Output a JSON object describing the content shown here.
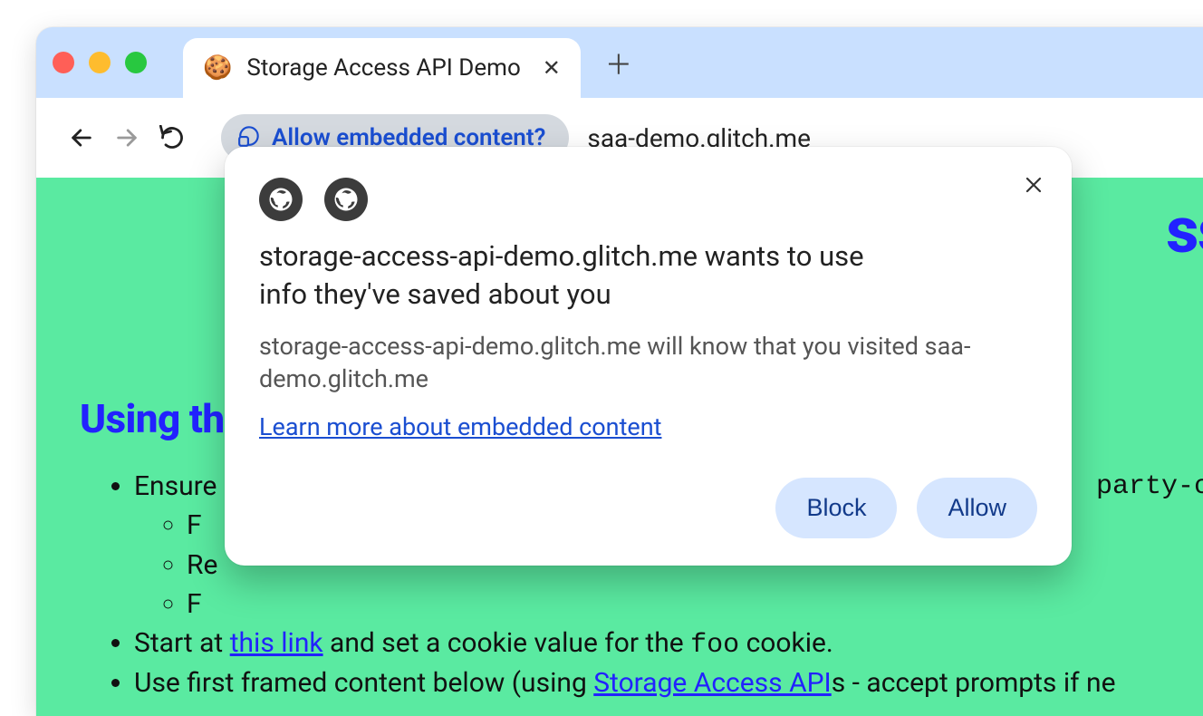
{
  "tab": {
    "title": "Storage Access API Demo",
    "favicon": "🍪"
  },
  "chip": {
    "label": "Allow embedded content?"
  },
  "url": "saa-demo.glitch.me",
  "page": {
    "big_heading_fragment": "ss A",
    "section_heading": "Using thi",
    "li_ensure": "Ensure ",
    "li_sub1": "F",
    "li_sub2": "Re",
    "li_sub3": "F",
    "li_flag_suffix": "party-coo",
    "li_start_prefix": "Start at ",
    "li_start_link": "this link",
    "li_start_mid": " and set a cookie value for the ",
    "li_start_code": "foo",
    "li_start_suffix": " cookie.",
    "li_first_prefix": "Use first framed content below (using ",
    "li_first_link": "Storage Access API",
    "li_first_suffix": "s - accept prompts if ne"
  },
  "bubble": {
    "title": "storage-access-api-demo.glitch.me wants to use info they've saved about you",
    "subtitle": "storage-access-api-demo.glitch.me will know that you visited saa-demo.glitch.me",
    "learn_more": "Learn more about embedded content",
    "block": "Block",
    "allow": "Allow"
  }
}
